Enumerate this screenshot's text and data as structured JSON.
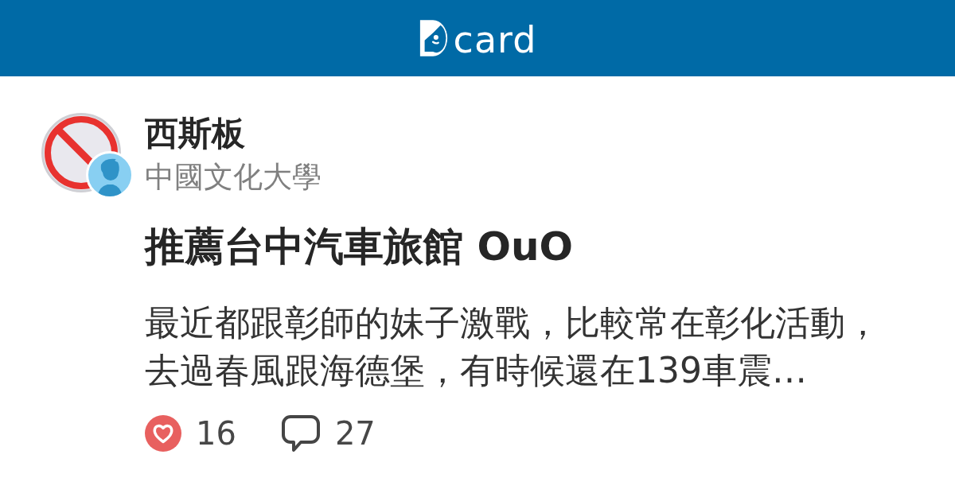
{
  "header": {
    "logo_text": "card"
  },
  "post": {
    "forum": {
      "name": "西斯板"
    },
    "author": {
      "school": "中國文化大學"
    },
    "title": "推薦台中汽車旅館 OuO",
    "excerpt": "最近都跟彰師的妹子激戰，比較常在彰化活動，去過春風跟海德堡，有時候還在139車震…",
    "likes": "16",
    "comments": "27"
  }
}
